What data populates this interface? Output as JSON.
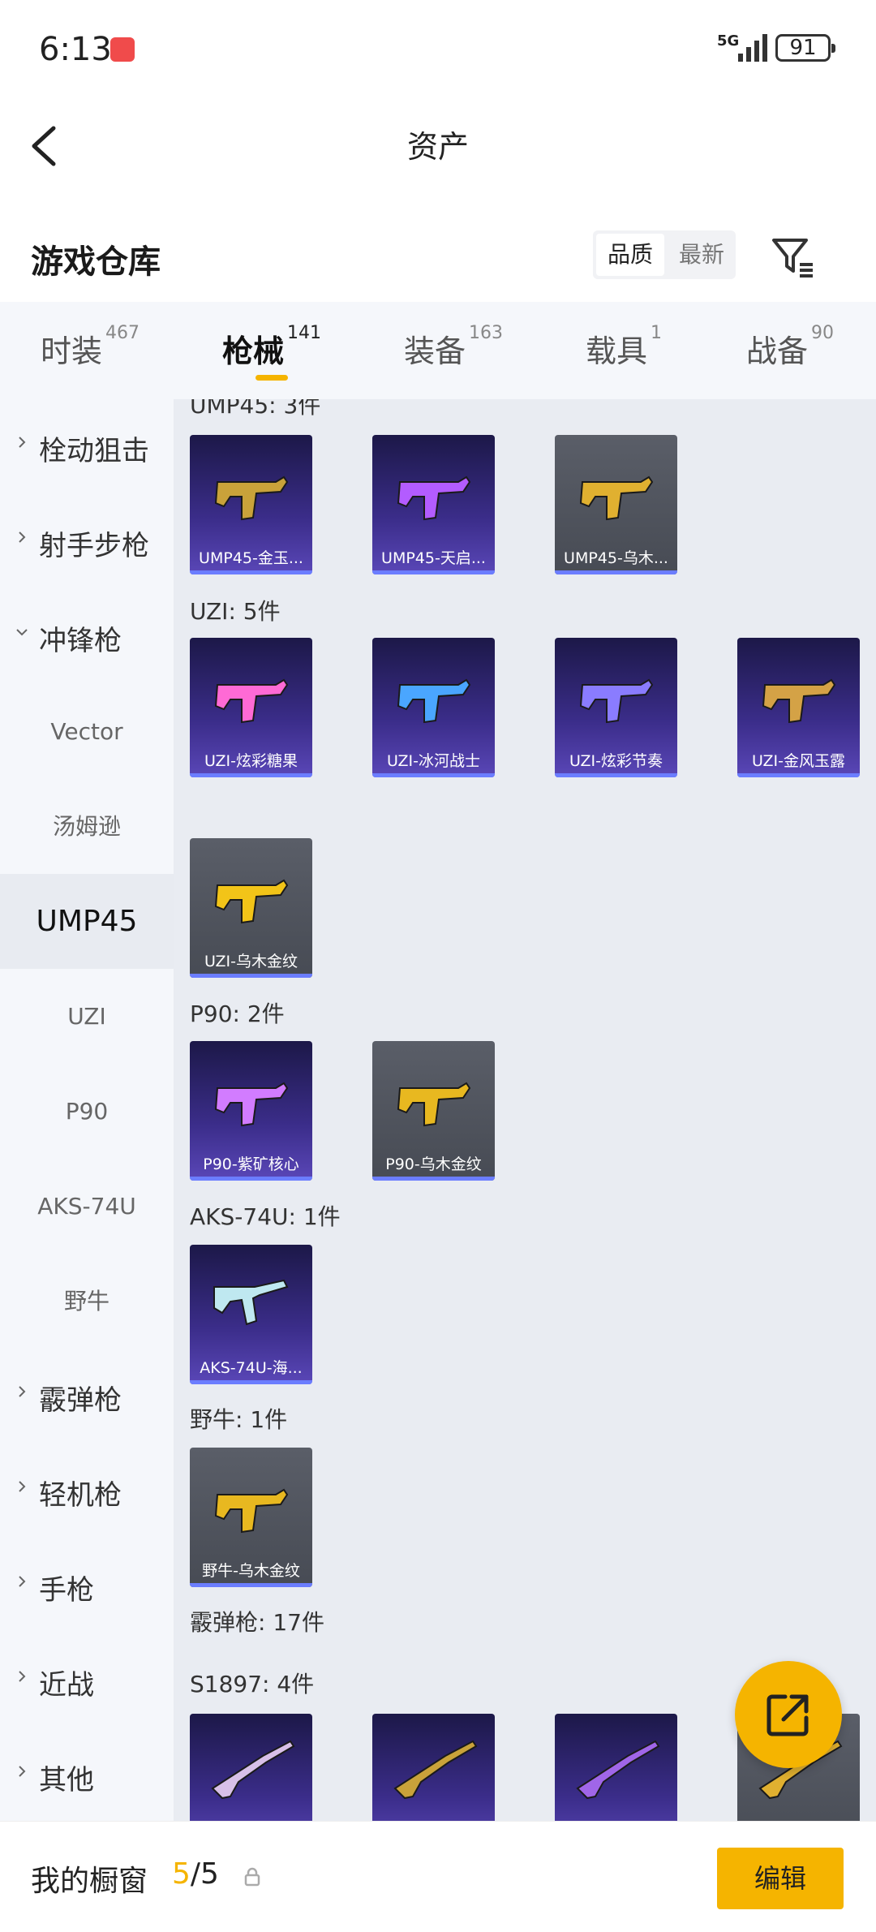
{
  "status_bar": {
    "time": "6:13",
    "network": "5G",
    "battery": "91"
  },
  "header": {
    "title": "资产"
  },
  "warehouse": {
    "title": "游戏仓库",
    "sort_options": [
      "品质",
      "最新"
    ],
    "active_sort": "品质"
  },
  "tabs": [
    {
      "label": "时装",
      "count": "467"
    },
    {
      "label": "枪械",
      "count": "141",
      "active": true
    },
    {
      "label": "装备",
      "count": "163"
    },
    {
      "label": "载具",
      "count": "1"
    },
    {
      "label": "战备",
      "count": "90"
    }
  ],
  "sidebar": {
    "top_categories": [
      "栓动狙击",
      "射手步枪"
    ],
    "expanded_category": "冲锋枪",
    "sub_items": [
      "Vector",
      "汤姆逊",
      "UMP45",
      "UZI",
      "P90",
      "AKS-74U",
      "野牛"
    ],
    "active_sub": "UMP45",
    "bottom_categories": [
      "霰弹枪",
      "轻机枪",
      "手枪",
      "近战",
      "其他"
    ]
  },
  "groups": [
    {
      "title": "UMP45: 3件",
      "items": [
        {
          "name": "UMP45-金玉...",
          "bg": "purple",
          "color": "#c9a23a"
        },
        {
          "name": "UMP45-天启...",
          "bg": "purple",
          "color": "#b35cff"
        },
        {
          "name": "UMP45-乌木...",
          "bg": "gray",
          "color": "#e0b030"
        }
      ]
    },
    {
      "title": "UZI: 5件",
      "items": [
        {
          "name": "UZI-炫彩糖果",
          "bg": "purple",
          "color": "#ff6ad5"
        },
        {
          "name": "UZI-冰河战士",
          "bg": "purple",
          "color": "#4aa6ff"
        },
        {
          "name": "UZI-炫彩节奏",
          "bg": "purple",
          "color": "#8a7cff"
        },
        {
          "name": "UZI-金风玉露",
          "bg": "purple",
          "color": "#d4a246"
        },
        {
          "name": "UZI-乌木金纹",
          "bg": "gray",
          "color": "#f2c418"
        }
      ]
    },
    {
      "title": "P90: 2件",
      "items": [
        {
          "name": "P90-紫矿核心",
          "bg": "purple",
          "color": "#d27cff"
        },
        {
          "name": "P90-乌木金纹",
          "bg": "gray",
          "color": "#e8b820"
        }
      ]
    },
    {
      "title": "AKS-74U: 1件",
      "items": [
        {
          "name": "AKS-74U-海...",
          "bg": "purple",
          "color": "#bfe8f0"
        }
      ]
    },
    {
      "title": "野牛: 1件",
      "items": [
        {
          "name": "野牛-乌木金纹",
          "bg": "gray",
          "color": "#e8b820"
        }
      ]
    }
  ],
  "extra_sections": [
    "霰弹枪: 17件",
    "S1897: 4件"
  ],
  "s1897_items": [
    {
      "bg": "purple",
      "color": "#d8c0e8"
    },
    {
      "bg": "purple",
      "color": "#c9a23a"
    },
    {
      "bg": "purple",
      "color": "#a066e8"
    },
    {
      "bg": "gray",
      "color": "#e0b030"
    }
  ],
  "bottom_bar": {
    "label": "我的橱窗",
    "count_current": "5",
    "count_total": "/5",
    "edit_label": "编辑"
  }
}
